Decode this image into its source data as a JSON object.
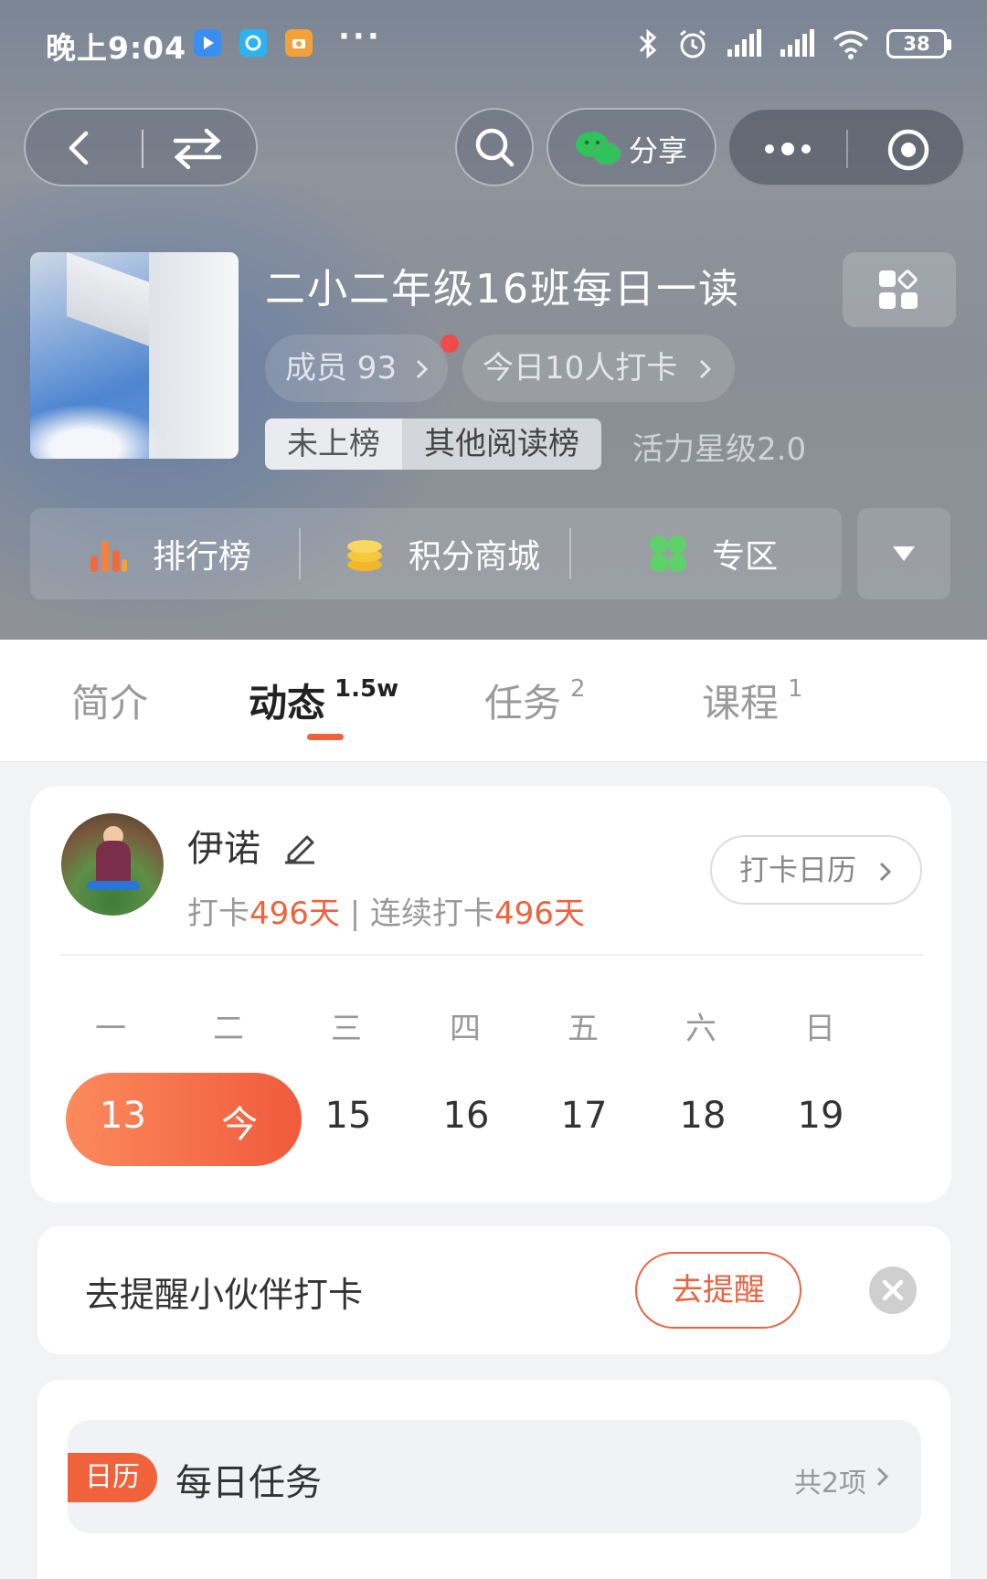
{
  "status_bar": {
    "time": "晚上9:04",
    "dots": "···",
    "battery": "38",
    "icons": [
      "video-app-icon",
      "browser-app-icon",
      "camera-app-icon",
      "bluetooth-icon",
      "alarm-icon",
      "signal-icon",
      "signal-icon",
      "wifi-icon",
      "battery-icon"
    ]
  },
  "top_nav": {
    "share_label": "分享",
    "icons": [
      "back-icon",
      "switch-icon",
      "search-icon",
      "wechat-icon",
      "more-icon",
      "target-icon"
    ]
  },
  "group": {
    "title": "二小二年级16班每日一读",
    "members_label": "成员 93",
    "today_checkin_label": "今日10人打卡",
    "rank_status": "未上榜",
    "rank_other": "其他阅读榜",
    "vitality": "活力星级2.0"
  },
  "func_bar": {
    "items": [
      {
        "label": "排行榜",
        "icon": "bar-chart-icon"
      },
      {
        "label": "积分商城",
        "icon": "coins-icon"
      },
      {
        "label": "专区",
        "icon": "clover-icon"
      }
    ]
  },
  "tabs": [
    {
      "label": "简介",
      "badge": ""
    },
    {
      "label": "动态",
      "badge": "1.5w"
    },
    {
      "label": "任务",
      "badge": "2"
    },
    {
      "label": "课程",
      "badge": "1"
    }
  ],
  "active_tab": "动态",
  "checkin": {
    "user_name": "伊诺",
    "stat_prefix": "打卡",
    "stat_days": "496天",
    "stat_sep": " | 连续打卡",
    "stat_streak": "496天",
    "calendar_button": "打卡日历",
    "weekdays": [
      "一",
      "二",
      "三",
      "四",
      "五",
      "六",
      "日"
    ],
    "dates": [
      "13",
      "今",
      "15",
      "16",
      "17",
      "18",
      "19"
    ]
  },
  "reminder": {
    "text": "去提醒小伙伴打卡",
    "button": "去提醒"
  },
  "task": {
    "tag": "日历",
    "title": "每日任务",
    "count": "共2项"
  },
  "colors": {
    "accent": "#f0623c",
    "accent_light": "#fb8a5c"
  }
}
